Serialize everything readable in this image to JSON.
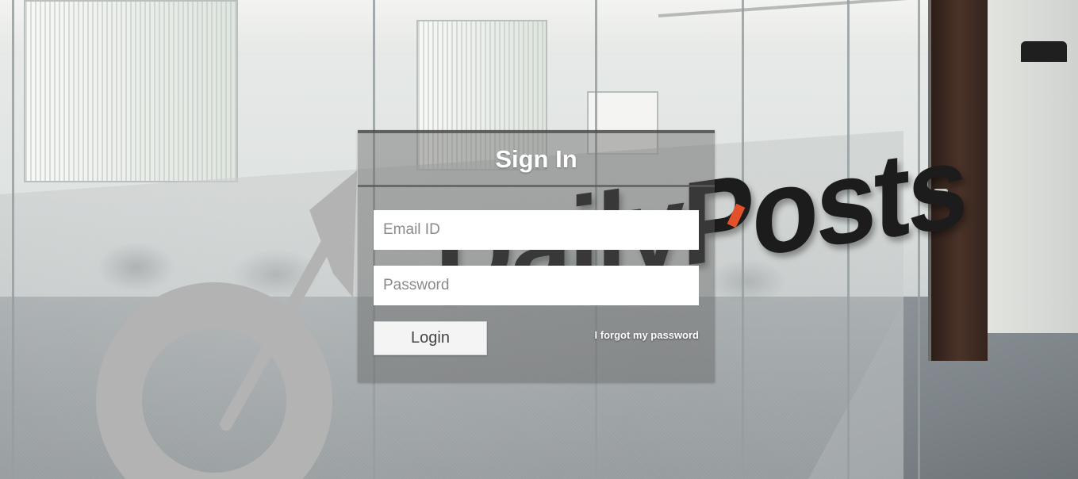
{
  "signin": {
    "title": "Sign In",
    "email_placeholder": "Email ID",
    "email_value": "",
    "password_placeholder": "Password",
    "password_value": "",
    "login_label": "Login",
    "forgot_label": "I forgot my password"
  },
  "background": {
    "wordmark": "DailyPosts",
    "accent_color": "#e2512a"
  }
}
